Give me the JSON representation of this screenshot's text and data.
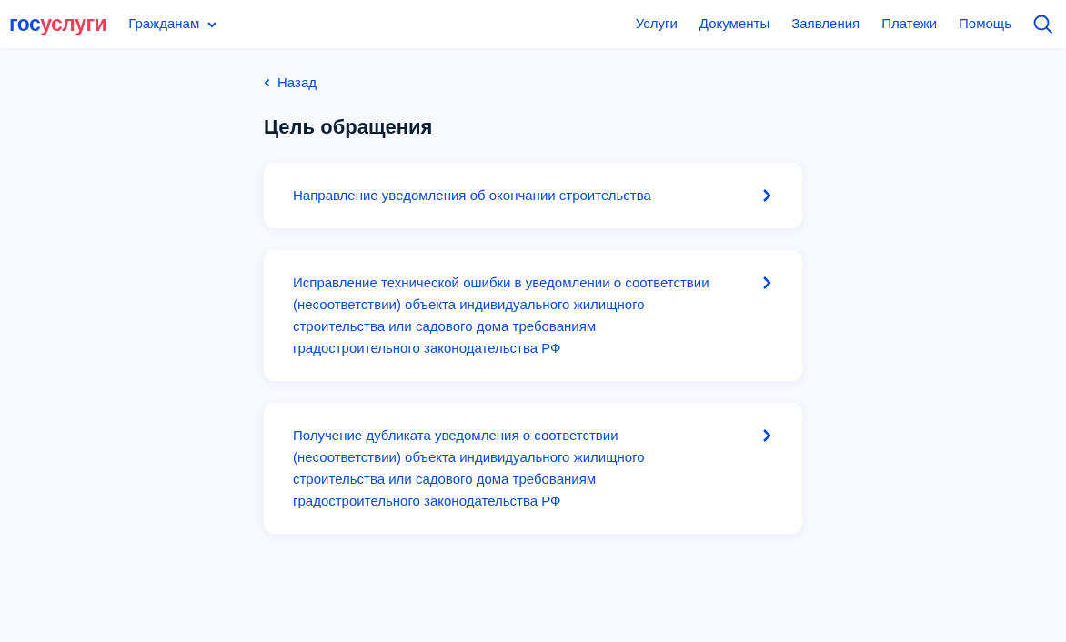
{
  "header": {
    "logo": {
      "part1": "гос",
      "part2": "услуги"
    },
    "audience_menu": "Гражданам",
    "nav": [
      "Услуги",
      "Документы",
      "Заявления",
      "Платежи",
      "Помощь"
    ]
  },
  "back_link": "Назад",
  "title": "Цель обращения",
  "options": [
    {
      "label": "Направление уведомления об окончании строительства"
    },
    {
      "label": "Исправление технической ошибки в уведомлении о соответствии (несоответствии) объекта индивидуального жилищного строительства или садового дома требованиям градостроительного законодательства РФ"
    },
    {
      "label": "Получение дубликата уведомления о соответствии (несоответствии) объекта индивидуального жилищного строительства или садового дома требованиям градостроительного законодательства РФ"
    }
  ]
}
